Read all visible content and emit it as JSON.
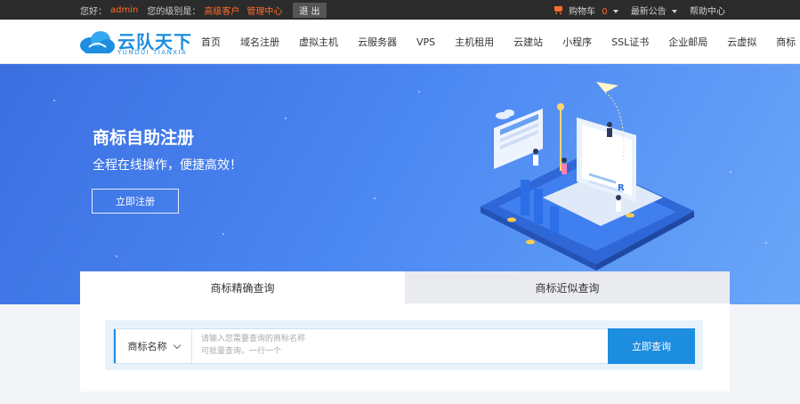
{
  "topbar": {
    "welcome_label": "您好：",
    "username": "admin",
    "level_label": "您的级别是：",
    "level_value": "高级客户",
    "admin_center": "管理中心",
    "logout": "退 出",
    "cart_label": "购物车",
    "cart_count": "0",
    "announcements": "最新公告",
    "help_center": "帮助中心"
  },
  "logo": {
    "cn": "云队天下",
    "en": "YUNDUI TIANXIA"
  },
  "nav": [
    "首页",
    "域名注册",
    "虚拟主机",
    "云服务器",
    "VPS",
    "主机租用",
    "云建站",
    "小程序",
    "SSL证书",
    "企业邮局",
    "云虚拟",
    "商标"
  ],
  "banner": {
    "title": "商标自助注册",
    "subtitle": "全程在线操作，便捷高效！",
    "cta": "立即注册",
    "badge_letter": "R"
  },
  "tabs": [
    {
      "label": "商标精确查询",
      "active": true
    },
    {
      "label": "商标近似查询",
      "active": false
    }
  ],
  "search": {
    "select_value": "商标名称",
    "placeholder_line1": "请输入您需要查询的商标名称",
    "placeholder_line2": "可批量查询，一行一个",
    "button": "立即查询"
  },
  "colors": {
    "accent": "#1d8de0",
    "orange": "#ff6b2b",
    "topbar_bg": "#2b2b2b"
  }
}
